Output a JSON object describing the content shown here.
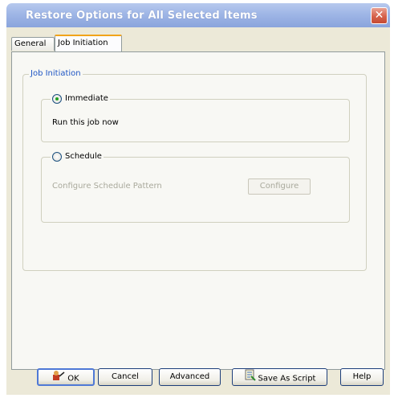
{
  "window": {
    "title": "Restore Options for All Selected Items",
    "close_label": "✕"
  },
  "tabs": [
    {
      "label": "General",
      "active": false
    },
    {
      "label": "Job Initiation",
      "active": true
    }
  ],
  "job_initiation": {
    "group_title": "Job Initiation",
    "immediate": {
      "label": "Immediate",
      "selected": true,
      "description": "Run this job now"
    },
    "schedule": {
      "label": "Schedule",
      "selected": false,
      "pattern_label": "Configure Schedule Pattern",
      "configure_button": "Configure",
      "enabled": false
    }
  },
  "footer_buttons": {
    "ok": "OK",
    "cancel": "Cancel",
    "advanced": "Advanced",
    "save_as_script": "Save As Script",
    "help": "Help"
  },
  "icons": {
    "ok": "ok-user-icon",
    "save_as_script": "script-icon"
  },
  "colors": {
    "accent_tab": "#f1a41a",
    "group_title": "#1f56c4",
    "titlebar": "#9fb6e6",
    "close_button": "#d6614a"
  }
}
